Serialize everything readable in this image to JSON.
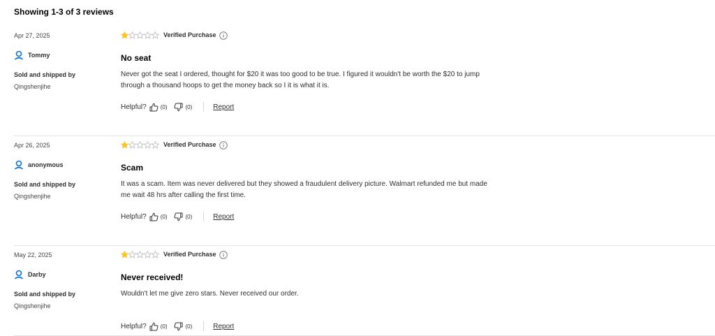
{
  "summary": "Showing 1-3 of 3 reviews",
  "labels": {
    "sold_shipped": "Sold and shipped by",
    "verified": "Verified Purchase",
    "helpful": "Helpful?",
    "report": "Report"
  },
  "colors": {
    "star_filled": "#ffc220",
    "star_empty": "#b9babc",
    "user_icon": "#0071dc"
  },
  "reviews": [
    {
      "date": "Apr 27, 2025",
      "user": "Tommy",
      "seller": "Qingshenjihe",
      "rating": 1,
      "max_rating": 5,
      "title": "No seat",
      "text": "Never got the seat I ordered, thought for $20 it was too good to be true. I figured it wouldn't be worth the $20 to jump through a thousand hoops to get the money back so I it is what it is.",
      "helpful_up": "(0)",
      "helpful_down": "(0)"
    },
    {
      "date": "Apr 26, 2025",
      "user": "anonymous",
      "seller": "Qingshenjihe",
      "rating": 1,
      "max_rating": 5,
      "title": "Scam",
      "text": "It was a scam. Item was never delivered but they showed a fraudulent delivery picture. Walmart refunded me but made me wait 48 hrs after calling the first time.",
      "helpful_up": "(0)",
      "helpful_down": "(0)"
    },
    {
      "date": "May 22, 2025",
      "user": "Darby",
      "seller": "Qingshenjihe",
      "rating": 1,
      "max_rating": 5,
      "title": "Never received!",
      "text": "Wouldn't let me give zero stars. Never received our order.",
      "helpful_up": "(0)",
      "helpful_down": "(0)"
    }
  ]
}
